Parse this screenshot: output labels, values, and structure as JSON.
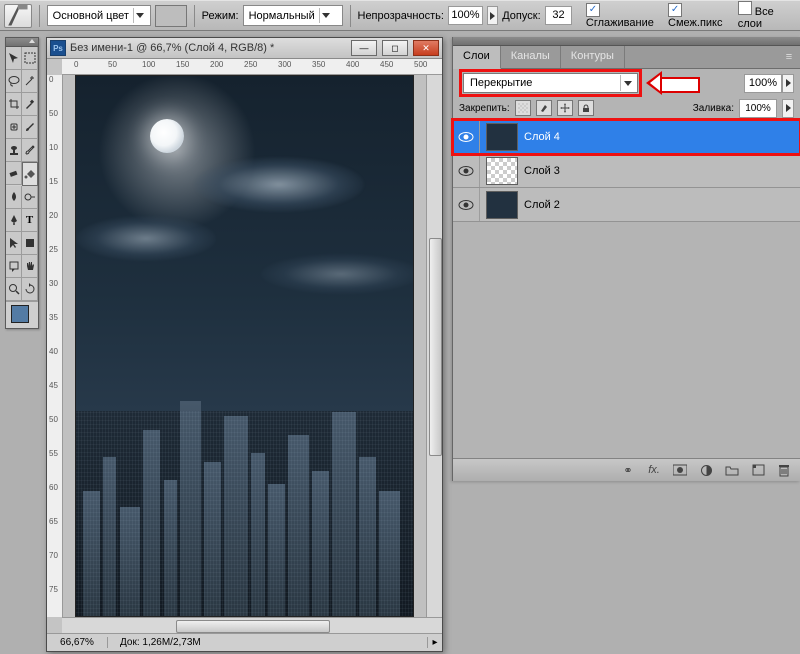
{
  "optionsBar": {
    "fg_label": "Основной цвет",
    "mode_label": "Режим:",
    "mode_value": "Нормальный",
    "opacity_label": "Непрозрачность:",
    "opacity_value": "100%",
    "tolerance_label": "Допуск:",
    "tolerance_value": "32",
    "antialias_label": "Сглаживание",
    "contiguous_label": "Смеж.пикс",
    "alllayers_label": "Все слои"
  },
  "document": {
    "title": "Без имени-1 @ 66,7% (Слой 4, RGB/8) *",
    "zoom": "66,67%",
    "docinfo": "Док: 1,26M/2,73M",
    "ruler_h": [
      "0",
      "50",
      "100",
      "150",
      "200",
      "250",
      "300",
      "350",
      "400",
      "450",
      "500"
    ],
    "ruler_v": [
      "0",
      "50",
      "10",
      "15",
      "20",
      "25",
      "30",
      "35",
      "40",
      "45",
      "50",
      "55",
      "60",
      "65",
      "70",
      "75"
    ]
  },
  "layersPanel": {
    "tabs": {
      "layers": "Слои",
      "channels": "Каналы",
      "paths": "Контуры"
    },
    "blend_mode": "Перекрытие",
    "opacity_value": "100%",
    "lock_label": "Закрепить:",
    "fill_label": "Заливка:",
    "fill_value": "100%",
    "layers": [
      {
        "name": "Слой 4",
        "selected": true,
        "thumb": "scene"
      },
      {
        "name": "Слой 3",
        "selected": false,
        "thumb": "checker"
      },
      {
        "name": "Слой 2",
        "selected": false,
        "thumb": "scene"
      }
    ]
  }
}
